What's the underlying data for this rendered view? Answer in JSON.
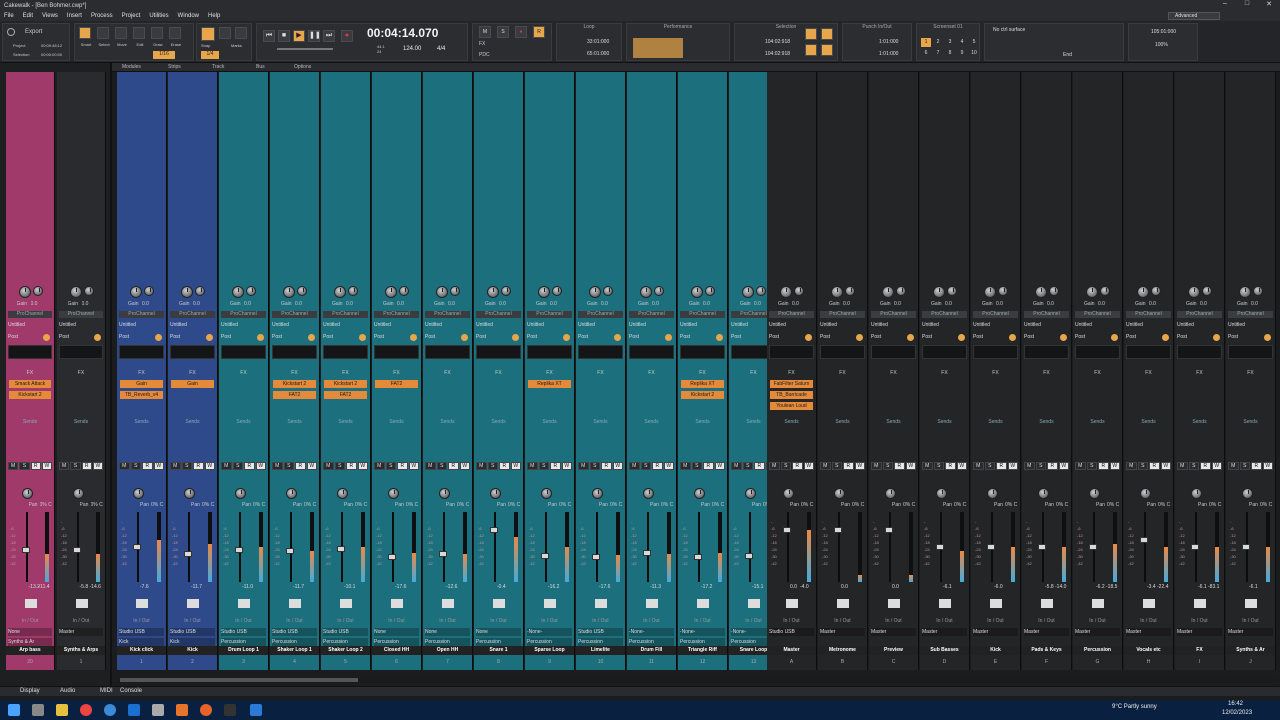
{
  "window": {
    "title": "Cakewalk - [Ben Bohmer.cwp*]",
    "workspace": "Advanced"
  },
  "menu": [
    "File",
    "Edit",
    "Views",
    "Insert",
    "Process",
    "Project",
    "Utilities",
    "Window",
    "Help"
  ],
  "control_bar": {
    "export_label": "Export",
    "project_label": "Project",
    "selection_label": "Selection",
    "project_time": "00:09:48:12",
    "selection_time": "00:00:00:00",
    "tools": [
      "Smart",
      "Select",
      "Move",
      "Edit",
      "Draw",
      "Erase"
    ],
    "snap_label": "Snap",
    "marks_label": "Marks",
    "snap_value": "1/16",
    "snap_value2": "1/4",
    "time": "00:04:14.070",
    "tempo": "124.00",
    "meter": "4/4",
    "sr": "44.1",
    "bits": "24",
    "loop_label": "Loop",
    "loop_start": "33:01:000",
    "loop_end": "65:01:000",
    "performance_label": "Performance",
    "selection_mod_label": "Selection",
    "sel_start": "104:02:918",
    "sel_end": "104:02:918",
    "punch_label": "Punch In/Out",
    "punch_start": "1:01:000",
    "punch_end": "1:01:000",
    "screenset_label": "Screenset 01",
    "screensets": [
      "1",
      "2",
      "3",
      "4",
      "5",
      "6",
      "7",
      "8",
      "9",
      "10"
    ],
    "ctrl_surface": "No ctrl surface",
    "end_label": "End",
    "markers_time": "105:01:000",
    "zoom": "100%",
    "fx_label": "FX",
    "pdc_label": "PDC"
  },
  "subbar": {
    "modules": "Modules",
    "strips": "Strips",
    "track": "Track",
    "bus": "Bus",
    "options": "Options"
  },
  "common": {
    "gain": "Gain",
    "pan": "Pan",
    "post": "Post",
    "untitled": "Untitled",
    "prochannel": "ProChannel",
    "fx": "FX",
    "sends": "Sends",
    "inout": "In / Out",
    "gain_val": "0.0",
    "pan_val": "C",
    "pan_pct": "0% C"
  },
  "inspector": [
    {
      "name": "Arp bass",
      "num": "20",
      "color": "#a03a6a",
      "fx": [
        "Smack Attack",
        "Kickstart 2"
      ],
      "io": [
        "None",
        "Synths & Ar"
      ],
      "peak": "-13.2",
      "peak2": "-11.4"
    },
    {
      "name": "Synths & Arps",
      "num": "1",
      "color": "#2a2b2e",
      "fx": [],
      "io": [
        "Master"
      ],
      "peak": "-5.8",
      "peak2": "-14.6"
    }
  ],
  "tracks": [
    {
      "name": "Kick click",
      "num": "1",
      "color": "#2f4a8a",
      "fx": [
        "Gain",
        "TB_Reverb_v4"
      ],
      "io": [
        "Studio USB",
        "Kick"
      ],
      "peak": "-7.6",
      "fader": 0.55,
      "meter": 0.6
    },
    {
      "name": "Kick",
      "num": "2",
      "color": "#2f4a8a",
      "fx": [
        "Gain"
      ],
      "io": [
        "Studio USB",
        "Kick"
      ],
      "peak": "-11.7",
      "fader": 0.45,
      "meter": 0.55
    },
    {
      "name": "Drum Loop 1",
      "num": "3",
      "color": "#1c6f7c",
      "fx": [],
      "io": [
        "Studio USB",
        "Percussion"
      ],
      "peak": "-11.0",
      "fader": 0.5,
      "meter": 0.5
    },
    {
      "name": "Shaker Loop 1",
      "num": "4",
      "color": "#1c6f7c",
      "fx": [
        "Kickstart 2",
        "FAT2"
      ],
      "io": [
        "Studio USB",
        "Percussion"
      ],
      "peak": "-11.7",
      "fader": 0.48,
      "meter": 0.45
    },
    {
      "name": "Shaker Loop 2",
      "num": "5",
      "color": "#1c6f7c",
      "fx": [
        "Kickstart 2",
        "FAT2"
      ],
      "io": [
        "Studio USB",
        "Percussion"
      ],
      "peak": "-10.1",
      "fader": 0.52,
      "meter": 0.5
    },
    {
      "name": "Closed HH",
      "num": "6",
      "color": "#1c6f7c",
      "fx": [
        "FAT2"
      ],
      "io": [
        "None",
        "Percussion"
      ],
      "peak": "-17.6",
      "fader": 0.4,
      "meter": 0.42
    },
    {
      "name": "Open HH",
      "num": "7",
      "color": "#1c6f7c",
      "fx": [],
      "io": [
        "None",
        "Percussion"
      ],
      "peak": "-12.6",
      "fader": 0.45,
      "meter": 0.4
    },
    {
      "name": "Snare 1",
      "num": "8",
      "color": "#1c6f7c",
      "fx": [],
      "io": [
        "None",
        "Percussion"
      ],
      "peak": "-0.4",
      "fader": 0.78,
      "meter": 0.65
    },
    {
      "name": "Sparse Loop",
      "num": "9",
      "color": "#1c6f7c",
      "fx": [
        "Replika XT"
      ],
      "io": [
        "-None-",
        "Percussion"
      ],
      "peak": "-16.2",
      "fader": 0.42,
      "meter": 0.5
    },
    {
      "name": "Limelite",
      "num": "10",
      "color": "#1c6f7c",
      "fx": [],
      "io": [
        "Studio USB",
        "Percussion"
      ],
      "peak": "-17.6",
      "fader": 0.4,
      "meter": 0.38
    },
    {
      "name": "Drum Fill",
      "num": "11",
      "color": "#1c6f7c",
      "fx": [],
      "io": [
        "-None-",
        "Percussion"
      ],
      "peak": "-11.3",
      "fader": 0.46,
      "meter": 0.4
    },
    {
      "name": "Triangle Riff",
      "num": "12",
      "color": "#1c6f7c",
      "fx": [
        "Replika XT",
        "Kickstart 2"
      ],
      "io": [
        "-None-",
        "Percussion"
      ],
      "peak": "-17.2",
      "fader": 0.4,
      "meter": 0.42
    },
    {
      "name": "Snare Loop",
      "num": "13",
      "color": "#1c6f7c",
      "fx": [],
      "io": [
        "-None-",
        "Percussion"
      ],
      "peak": "-15.1",
      "fader": 0.42,
      "meter": 0.4
    }
  ],
  "buses": [
    {
      "name": "Master",
      "num": "A",
      "fx": [
        "FabFilter Saturn",
        "TB_Barricade",
        "Youlean Loud"
      ],
      "io": [
        "Studio USB"
      ],
      "peak": "0.0",
      "peak2": "-4.0",
      "fader": 0.78,
      "meter": 0.75
    },
    {
      "name": "Metronome",
      "num": "B",
      "fx": [],
      "io": [
        "Master"
      ],
      "peak": "0.0",
      "fader": 0.78,
      "meter": 0.1
    },
    {
      "name": "Preview",
      "num": "C",
      "fx": [],
      "io": [
        "Master"
      ],
      "peak": "0.0",
      "fader": 0.78,
      "meter": 0.1
    },
    {
      "name": "Sub Basses",
      "num": "D",
      "fx": [],
      "io": [
        "Master"
      ],
      "peak": "-6.1",
      "fader": 0.55,
      "meter": 0.45
    },
    {
      "name": "Kick",
      "num": "E",
      "fx": [],
      "io": [
        "Master"
      ],
      "peak": "-6.0",
      "fader": 0.55,
      "meter": 0.5
    },
    {
      "name": "Pads & Keys",
      "num": "F",
      "fx": [],
      "io": [
        "Master"
      ],
      "peak": "-5.8",
      "peak2": "-14.0",
      "fader": 0.55,
      "meter": 0.5
    },
    {
      "name": "Percussion",
      "num": "G",
      "fx": [],
      "io": [
        "Master"
      ],
      "peak": "-6.2",
      "peak2": "-18.5",
      "fader": 0.55,
      "meter": 0.55
    },
    {
      "name": "Vocals etc",
      "num": "H",
      "fx": [],
      "io": [
        "Master"
      ],
      "peak": "-3.4",
      "peak2": "-22.4",
      "fader": 0.65,
      "meter": 0.5
    },
    {
      "name": "FX",
      "num": "I",
      "fx": [],
      "io": [
        "Master"
      ],
      "peak": "-6.1",
      "peak2": "-83.1",
      "fader": 0.55,
      "meter": 0.5
    },
    {
      "name": "Synths & Ar",
      "num": "J",
      "fx": [],
      "io": [
        "Master"
      ],
      "peak": "-6.1",
      "fader": 0.55,
      "meter": 0.5
    }
  ],
  "bottom_tabs": [
    "Display",
    "Audio",
    "MIDI"
  ],
  "console_tab": "Console",
  "tray": {
    "weather": "9°C  Partly sunny",
    "time": "16:42",
    "date": "12/02/2023"
  }
}
